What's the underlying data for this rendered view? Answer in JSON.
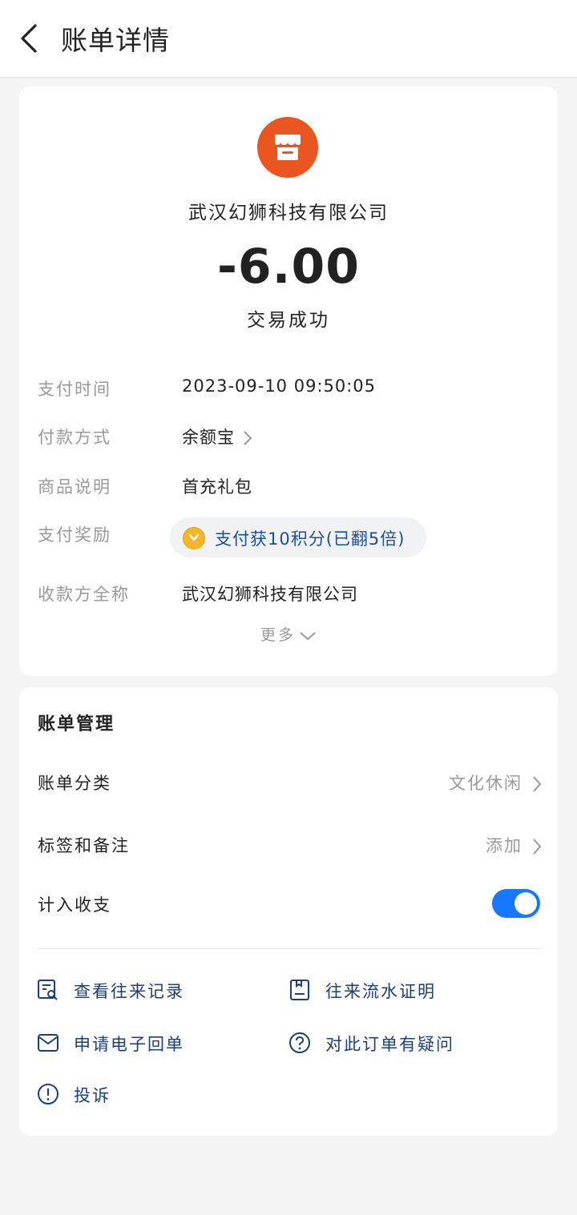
{
  "header": {
    "title": "账单详情"
  },
  "merchant": {
    "name": "武汉幻狮科技有限公司",
    "icon": "shop-icon",
    "icon_color": "#e9561f"
  },
  "amount": "-6.00",
  "status": "交易成功",
  "details": {
    "pay_time_label": "支付时间",
    "pay_time_value": "2023-09-10 09:50:05",
    "pay_method_label": "付款方式",
    "pay_method_value": "余额宝",
    "product_label": "商品说明",
    "product_value": "首充礼包",
    "reward_label": "支付奖励",
    "reward_value": "支付获10积分(已翻5倍)",
    "payee_label": "收款方全称",
    "payee_value": "武汉幻狮科技有限公司",
    "more_label": "更多"
  },
  "management": {
    "title": "账单管理",
    "category_label": "账单分类",
    "category_value": "文化休闲",
    "tags_label": "标签和备注",
    "tags_value": "添加",
    "include_label": "计入收支",
    "include_on": true,
    "toggle_color": "#1677ff"
  },
  "actions": {
    "view_records": "查看往来记录",
    "statement_proof": "往来流水证明",
    "e_receipt": "申请电子回单",
    "order_question": "对此订单有疑问",
    "complaint": "投诉"
  }
}
